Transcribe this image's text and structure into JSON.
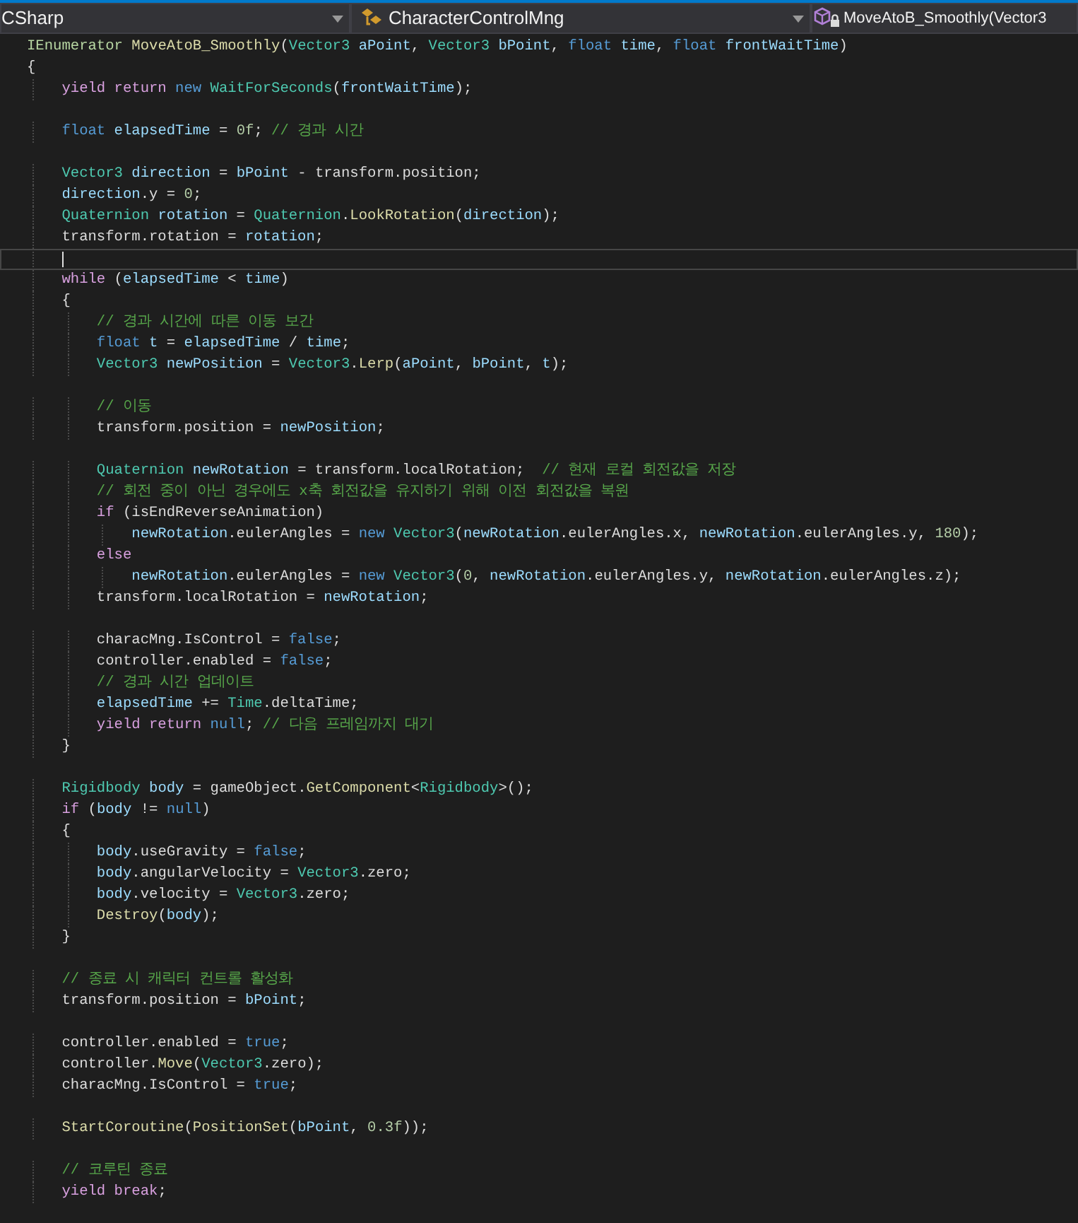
{
  "navigation_bar": [
    {
      "kind": "project",
      "text": "CSharp",
      "caret": true
    },
    {
      "kind": "class",
      "text": "CharacterControlMng",
      "caret": true
    },
    {
      "kind": "member",
      "text": "MoveAtoB_Smoothly(Vector3",
      "caret": false
    }
  ],
  "lines": [
    {
      "current": false,
      "tokens": [
        {
          "kind": "iface",
          "text": "IEnumerator "
        },
        {
          "kind": "method",
          "text": "MoveAtoB_Smoothly"
        },
        {
          "kind": "plain",
          "text": "("
        },
        {
          "kind": "type",
          "text": "Vector3 "
        },
        {
          "kind": "local",
          "text": "aPoint"
        },
        {
          "kind": "plain",
          "text": ", "
        },
        {
          "kind": "type",
          "text": "Vector3 "
        },
        {
          "kind": "local",
          "text": "bPoint"
        },
        {
          "kind": "plain",
          "text": ", "
        },
        {
          "kind": "keyword",
          "text": "float "
        },
        {
          "kind": "local",
          "text": "time"
        },
        {
          "kind": "plain",
          "text": ", "
        },
        {
          "kind": "keyword",
          "text": "float "
        },
        {
          "kind": "local",
          "text": "frontWaitTime"
        },
        {
          "kind": "plain",
          "text": ")"
        }
      ]
    },
    {
      "current": false,
      "tokens": [
        {
          "kind": "plain",
          "text": "{"
        }
      ]
    },
    {
      "current": false,
      "tokens": [
        {
          "kind": "control",
          "text": "    yield return "
        },
        {
          "kind": "keyword",
          "text": "new "
        },
        {
          "kind": "type",
          "text": "WaitForSeconds"
        },
        {
          "kind": "plain",
          "text": "("
        },
        {
          "kind": "local",
          "text": "frontWaitTime"
        },
        {
          "kind": "plain",
          "text": ");"
        }
      ]
    },
    {
      "current": false
    },
    {
      "current": false,
      "tokens": [
        {
          "kind": "keyword",
          "text": "    float "
        },
        {
          "kind": "local",
          "text": "elapsedTime"
        },
        {
          "kind": "plain",
          "text": " = "
        },
        {
          "kind": "number",
          "text": "0f"
        },
        {
          "kind": "plain",
          "text": "; "
        },
        {
          "kind": "comment",
          "text": "// 경과 시간"
        }
      ]
    },
    {
      "current": false
    },
    {
      "current": false,
      "tokens": [
        {
          "kind": "type",
          "text": "    Vector3 "
        },
        {
          "kind": "local",
          "text": "direction"
        },
        {
          "kind": "plain",
          "text": " = "
        },
        {
          "kind": "local",
          "text": "bPoint"
        },
        {
          "kind": "plain",
          "text": " - transform.position;"
        }
      ]
    },
    {
      "current": false,
      "tokens": [
        {
          "kind": "local",
          "text": "    direction"
        },
        {
          "kind": "plain",
          "text": ".y = "
        },
        {
          "kind": "number",
          "text": "0"
        },
        {
          "kind": "plain",
          "text": ";"
        }
      ]
    },
    {
      "current": false,
      "tokens": [
        {
          "kind": "type",
          "text": "    Quaternion "
        },
        {
          "kind": "local",
          "text": "rotation"
        },
        {
          "kind": "plain",
          "text": " = "
        },
        {
          "kind": "type",
          "text": "Quaternion"
        },
        {
          "kind": "plain",
          "text": "."
        },
        {
          "kind": "method",
          "text": "LookRotation"
        },
        {
          "kind": "plain",
          "text": "("
        },
        {
          "kind": "local",
          "text": "direction"
        },
        {
          "kind": "plain",
          "text": ");"
        }
      ]
    },
    {
      "current": false,
      "tokens": [
        {
          "kind": "plain",
          "text": "    transform.rotation = "
        },
        {
          "kind": "local",
          "text": "rotation"
        },
        {
          "kind": "plain",
          "text": ";"
        }
      ]
    },
    {
      "current": true
    },
    {
      "current": false,
      "tokens": [
        {
          "kind": "control",
          "text": "    while "
        },
        {
          "kind": "plain",
          "text": "("
        },
        {
          "kind": "local",
          "text": "elapsedTime"
        },
        {
          "kind": "plain",
          "text": " < "
        },
        {
          "kind": "local",
          "text": "time"
        },
        {
          "kind": "plain",
          "text": ")"
        }
      ]
    },
    {
      "current": false,
      "tokens": [
        {
          "kind": "plain",
          "text": "    {"
        }
      ]
    },
    {
      "current": false,
      "tokens": [
        {
          "kind": "comment",
          "text": "        // 경과 시간에 따른 이동 보간"
        }
      ]
    },
    {
      "current": false,
      "tokens": [
        {
          "kind": "keyword",
          "text": "        float "
        },
        {
          "kind": "local",
          "text": "t"
        },
        {
          "kind": "plain",
          "text": " = "
        },
        {
          "kind": "local",
          "text": "elapsedTime"
        },
        {
          "kind": "plain",
          "text": " / "
        },
        {
          "kind": "local",
          "text": "time"
        },
        {
          "kind": "plain",
          "text": ";"
        }
      ]
    },
    {
      "current": false,
      "tokens": [
        {
          "kind": "type",
          "text": "        Vector3 "
        },
        {
          "kind": "local",
          "text": "newPosition"
        },
        {
          "kind": "plain",
          "text": " = "
        },
        {
          "kind": "type",
          "text": "Vector3"
        },
        {
          "kind": "plain",
          "text": "."
        },
        {
          "kind": "method",
          "text": "Lerp"
        },
        {
          "kind": "plain",
          "text": "("
        },
        {
          "kind": "local",
          "text": "aPoint"
        },
        {
          "kind": "plain",
          "text": ", "
        },
        {
          "kind": "local",
          "text": "bPoint"
        },
        {
          "kind": "plain",
          "text": ", "
        },
        {
          "kind": "local",
          "text": "t"
        },
        {
          "kind": "plain",
          "text": ");"
        }
      ]
    },
    {
      "current": false
    },
    {
      "current": false,
      "tokens": [
        {
          "kind": "comment",
          "text": "        // 이동"
        }
      ]
    },
    {
      "current": false,
      "tokens": [
        {
          "kind": "plain",
          "text": "        transform.position = "
        },
        {
          "kind": "local",
          "text": "newPosition"
        },
        {
          "kind": "plain",
          "text": ";"
        }
      ]
    },
    {
      "current": false
    },
    {
      "current": false,
      "tokens": [
        {
          "kind": "type",
          "text": "        Quaternion "
        },
        {
          "kind": "local",
          "text": "newRotation"
        },
        {
          "kind": "plain",
          "text": " = transform.localRotation;  "
        },
        {
          "kind": "comment",
          "text": "// 현재 로컬 회전값을 저장"
        }
      ]
    },
    {
      "current": false,
      "tokens": [
        {
          "kind": "comment",
          "text": "        // 회전 중이 아닌 경우에도 x축 회전값을 유지하기 위해 이전 회전값을 복원"
        }
      ]
    },
    {
      "current": false,
      "tokens": [
        {
          "kind": "control",
          "text": "        if "
        },
        {
          "kind": "plain",
          "text": "(isEndReverseAnimation)"
        }
      ]
    },
    {
      "current": false,
      "tokens": [
        {
          "kind": "local",
          "text": "            newRotation"
        },
        {
          "kind": "plain",
          "text": ".eulerAngles = "
        },
        {
          "kind": "keyword",
          "text": "new "
        },
        {
          "kind": "type",
          "text": "Vector3"
        },
        {
          "kind": "plain",
          "text": "("
        },
        {
          "kind": "local",
          "text": "newRotation"
        },
        {
          "kind": "plain",
          "text": ".eulerAngles.x, "
        },
        {
          "kind": "local",
          "text": "newRotation"
        },
        {
          "kind": "plain",
          "text": ".eulerAngles.y, "
        },
        {
          "kind": "number",
          "text": "180"
        },
        {
          "kind": "plain",
          "text": ");"
        }
      ]
    },
    {
      "current": false,
      "tokens": [
        {
          "kind": "control",
          "text": "        else"
        }
      ]
    },
    {
      "current": false,
      "tokens": [
        {
          "kind": "local",
          "text": "            newRotation"
        },
        {
          "kind": "plain",
          "text": ".eulerAngles = "
        },
        {
          "kind": "keyword",
          "text": "new "
        },
        {
          "kind": "type",
          "text": "Vector3"
        },
        {
          "kind": "plain",
          "text": "("
        },
        {
          "kind": "number",
          "text": "0"
        },
        {
          "kind": "plain",
          "text": ", "
        },
        {
          "kind": "local",
          "text": "newRotation"
        },
        {
          "kind": "plain",
          "text": ".eulerAngles.y, "
        },
        {
          "kind": "local",
          "text": "newRotation"
        },
        {
          "kind": "plain",
          "text": ".eulerAngles.z);"
        }
      ]
    },
    {
      "current": false,
      "tokens": [
        {
          "kind": "plain",
          "text": "        transform.localRotation = "
        },
        {
          "kind": "local",
          "text": "newRotation"
        },
        {
          "kind": "plain",
          "text": ";"
        }
      ]
    },
    {
      "current": false
    },
    {
      "current": false,
      "tokens": [
        {
          "kind": "plain",
          "text": "        characMng.IsControl = "
        },
        {
          "kind": "keyword",
          "text": "false"
        },
        {
          "kind": "plain",
          "text": ";"
        }
      ]
    },
    {
      "current": false,
      "tokens": [
        {
          "kind": "plain",
          "text": "        controller.enabled = "
        },
        {
          "kind": "keyword",
          "text": "false"
        },
        {
          "kind": "plain",
          "text": ";"
        }
      ]
    },
    {
      "current": false,
      "tokens": [
        {
          "kind": "comment",
          "text": "        // 경과 시간 업데이트"
        }
      ]
    },
    {
      "current": false,
      "tokens": [
        {
          "kind": "local",
          "text": "        elapsedTime"
        },
        {
          "kind": "plain",
          "text": " += "
        },
        {
          "kind": "type",
          "text": "Time"
        },
        {
          "kind": "plain",
          "text": ".deltaTime;"
        }
      ]
    },
    {
      "current": false,
      "tokens": [
        {
          "kind": "control",
          "text": "        yield return "
        },
        {
          "kind": "keyword",
          "text": "null"
        },
        {
          "kind": "plain",
          "text": "; "
        },
        {
          "kind": "comment",
          "text": "// 다음 프레임까지 대기"
        }
      ]
    },
    {
      "current": false,
      "tokens": [
        {
          "kind": "plain",
          "text": "    }"
        }
      ]
    },
    {
      "current": false
    },
    {
      "current": false,
      "tokens": [
        {
          "kind": "type",
          "text": "    Rigidbody "
        },
        {
          "kind": "local",
          "text": "body"
        },
        {
          "kind": "plain",
          "text": " = gameObject."
        },
        {
          "kind": "method",
          "text": "GetComponent"
        },
        {
          "kind": "plain",
          "text": "<"
        },
        {
          "kind": "type",
          "text": "Rigidbody"
        },
        {
          "kind": "plain",
          "text": ">();"
        }
      ]
    },
    {
      "current": false,
      "tokens": [
        {
          "kind": "control",
          "text": "    if "
        },
        {
          "kind": "plain",
          "text": "("
        },
        {
          "kind": "local",
          "text": "body"
        },
        {
          "kind": "plain",
          "text": " != "
        },
        {
          "kind": "keyword",
          "text": "null"
        },
        {
          "kind": "plain",
          "text": ")"
        }
      ]
    },
    {
      "current": false,
      "tokens": [
        {
          "kind": "plain",
          "text": "    {"
        }
      ]
    },
    {
      "current": false,
      "tokens": [
        {
          "kind": "local",
          "text": "        body"
        },
        {
          "kind": "plain",
          "text": ".useGravity = "
        },
        {
          "kind": "keyword",
          "text": "false"
        },
        {
          "kind": "plain",
          "text": ";"
        }
      ]
    },
    {
      "current": false,
      "tokens": [
        {
          "kind": "local",
          "text": "        body"
        },
        {
          "kind": "plain",
          "text": ".angularVelocity = "
        },
        {
          "kind": "type",
          "text": "Vector3"
        },
        {
          "kind": "plain",
          "text": ".zero;"
        }
      ]
    },
    {
      "current": false,
      "tokens": [
        {
          "kind": "local",
          "text": "        body"
        },
        {
          "kind": "plain",
          "text": ".velocity = "
        },
        {
          "kind": "type",
          "text": "Vector3"
        },
        {
          "kind": "plain",
          "text": ".zero;"
        }
      ]
    },
    {
      "current": false,
      "tokens": [
        {
          "kind": "method",
          "text": "        Destroy"
        },
        {
          "kind": "plain",
          "text": "("
        },
        {
          "kind": "local",
          "text": "body"
        },
        {
          "kind": "plain",
          "text": ");"
        }
      ]
    },
    {
      "current": false,
      "tokens": [
        {
          "kind": "plain",
          "text": "    }"
        }
      ]
    },
    {
      "current": false
    },
    {
      "current": false,
      "tokens": [
        {
          "kind": "comment",
          "text": "    // 종료 시 캐릭터 컨트롤 활성화"
        }
      ]
    },
    {
      "current": false,
      "tokens": [
        {
          "kind": "plain",
          "text": "    transform.position = "
        },
        {
          "kind": "local",
          "text": "bPoint"
        },
        {
          "kind": "plain",
          "text": ";"
        }
      ]
    },
    {
      "current": false
    },
    {
      "current": false,
      "tokens": [
        {
          "kind": "plain",
          "text": "    controller.enabled = "
        },
        {
          "kind": "keyword",
          "text": "true"
        },
        {
          "kind": "plain",
          "text": ";"
        }
      ]
    },
    {
      "current": false,
      "tokens": [
        {
          "kind": "plain",
          "text": "    controller."
        },
        {
          "kind": "method",
          "text": "Move"
        },
        {
          "kind": "plain",
          "text": "("
        },
        {
          "kind": "type",
          "text": "Vector3"
        },
        {
          "kind": "plain",
          "text": ".zero);"
        }
      ]
    },
    {
      "current": false,
      "tokens": [
        {
          "kind": "plain",
          "text": "    characMng.IsControl = "
        },
        {
          "kind": "keyword",
          "text": "true"
        },
        {
          "kind": "plain",
          "text": ";"
        }
      ]
    },
    {
      "current": false
    },
    {
      "current": false,
      "tokens": [
        {
          "kind": "method",
          "text": "    StartCoroutine"
        },
        {
          "kind": "plain",
          "text": "("
        },
        {
          "kind": "method",
          "text": "PositionSet"
        },
        {
          "kind": "plain",
          "text": "("
        },
        {
          "kind": "local",
          "text": "bPoint"
        },
        {
          "kind": "plain",
          "text": ", "
        },
        {
          "kind": "number",
          "text": "0.3f"
        },
        {
          "kind": "plain",
          "text": "));"
        }
      ]
    },
    {
      "current": false
    },
    {
      "current": false,
      "tokens": [
        {
          "kind": "comment",
          "text": "    // 코루틴 종료"
        }
      ]
    },
    {
      "current": false,
      "tokens": [
        {
          "kind": "control",
          "text": "    yield break"
        },
        {
          "kind": "plain",
          "text": ";"
        }
      ]
    }
  ]
}
